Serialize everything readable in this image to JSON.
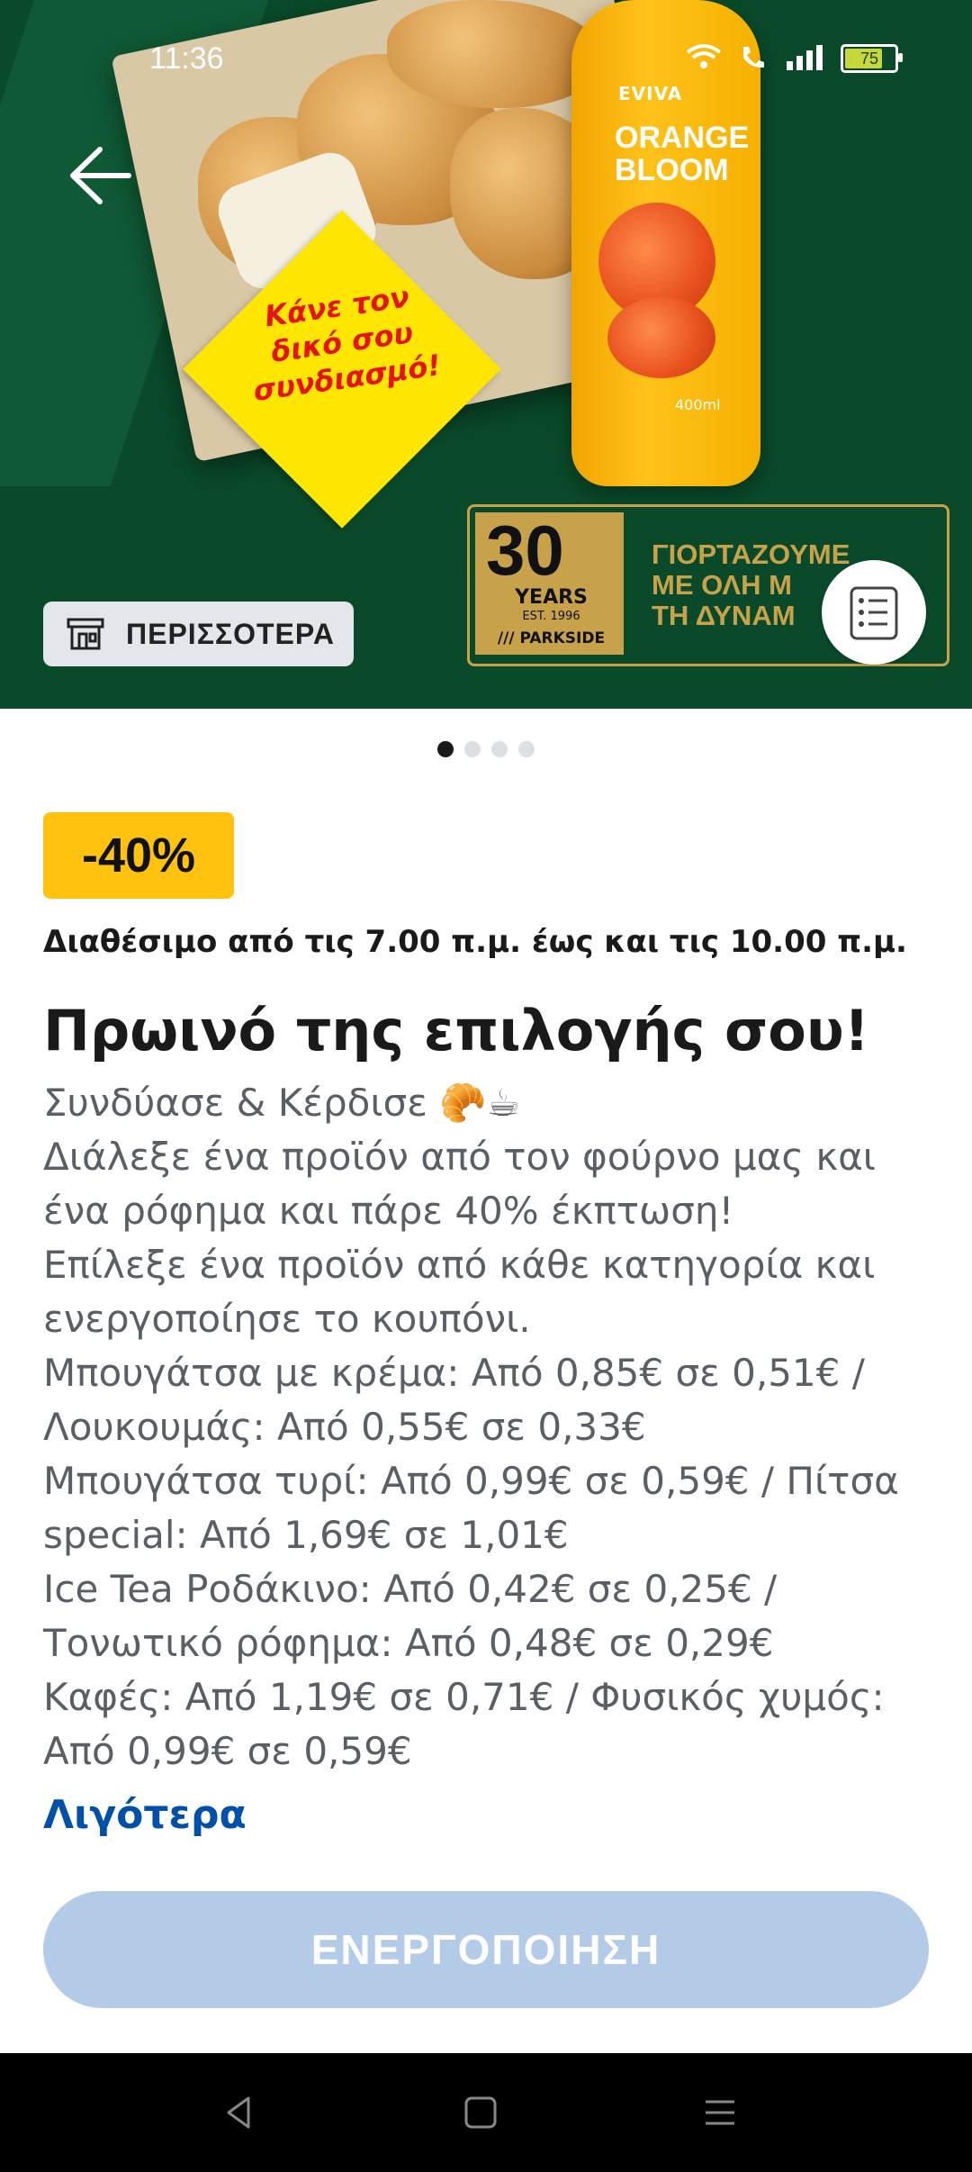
{
  "status_bar": {
    "time": "11:36",
    "battery": "75",
    "battery_level": 0.75,
    "icons": [
      "wifi-icon",
      "call-icon",
      "signal-icon",
      "battery-icon"
    ]
  },
  "hero": {
    "badge_text": [
      "Κάνε τον",
      "δικό σου",
      "συνδιασμό!"
    ],
    "bottle_brand": "EVIVA",
    "bottle_name": [
      "ORANGE",
      "BLOOM"
    ],
    "bottle_volume": "400ml",
    "promo_number": "30",
    "promo_years": "YEARS",
    "promo_est": "EST. 1996",
    "promo_brand": "/// PARKSIDE",
    "promo_slogan": [
      "ΓΙΟΡΤΑΖΟΥΜΕ",
      "ΜΕ ΟΛΗ Μ",
      "ΤΗ ΔΥΝΑΜ"
    ],
    "more_button_label": "ΠΕΡΙΣΣΟΤΕΡΑ"
  },
  "carousel": {
    "count": 4,
    "active_index": 0
  },
  "offer": {
    "discount_label": "-40%",
    "availability": "Διαθέσιμο από τις 7.00 π.μ. έως και τις 10.00 π.μ.",
    "title": "Πρωινό της επιλογής σου!",
    "description_lines": [
      "Συνδύασε & Κέρδισε 🥐☕",
      "Διάλεξε ένα προϊόν από τον φούρνο μας και",
      "ένα ρόφημα και πάρε 40% έκπτωση!",
      "Επίλεξε ένα προϊόν από κάθε κατηγορία και",
      "ενεργοποίησε το κουπόνι.",
      "Μπουγάτσα με κρέμα: Από 0,85€ σε 0,51€ /",
      "Λουκουμάς: Από 0,55€ σε 0,33€",
      "Μπουγάτσα τυρί: Από 0,99€ σε 0,59€ / Πίτσα",
      "special: Από 1,69€ σε 1,01€",
      "Ice Tea Ροδάκινο: Από 0,42€ σε 0,25€ /",
      "Τονωτικό ρόφημα: Από 0,48€ σε 0,29€",
      "Καφές: Από 1,19€ σε 0,71€ / Φυσικός χυμός:",
      "Από 0,99€ σε 0,59€"
    ],
    "less_link": "Λιγότερα",
    "activate_button": "ΕΝΕΡΓΟΠΟΙΗΣΗ"
  },
  "colors": {
    "hero_green": "#0a4a2a",
    "discount_yellow": "#ffc20e",
    "link_blue": "#0050aa",
    "button_disabled": "#b4cbe8"
  }
}
